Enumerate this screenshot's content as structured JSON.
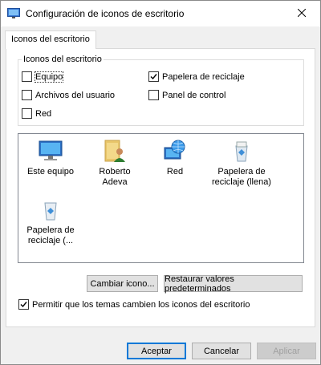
{
  "window": {
    "title": "Configuración de iconos de escritorio",
    "icon": "display-settings-icon",
    "close_icon": "close-icon"
  },
  "tabs": [
    {
      "label": "Iconos del escritorio",
      "selected": true
    }
  ],
  "desktop_icons_group": {
    "legend": "Iconos del escritorio",
    "checkboxes": [
      {
        "label": "Equipo",
        "checked": false
      },
      {
        "label": "Papelera de reciclaje",
        "checked": true
      },
      {
        "label": "Archivos del usuario",
        "checked": false
      },
      {
        "label": "Panel de control",
        "checked": false
      },
      {
        "label": "Red",
        "checked": false
      }
    ]
  },
  "icon_list": {
    "items": [
      {
        "label": "Este equipo",
        "icon": "computer-icon"
      },
      {
        "label": "Roberto Adeva",
        "icon": "user-folder-icon"
      },
      {
        "label": "Red",
        "icon": "network-globe-icon"
      },
      {
        "label": "Papelera de reciclaje (llena)",
        "icon": "recycle-bin-full-icon"
      },
      {
        "label": "Papelera de reciclaje (...",
        "icon": "recycle-bin-empty-icon"
      }
    ]
  },
  "buttons": {
    "change_icon": "Cambiar icono...",
    "restore_defaults": "Restaurar valores predeterminados",
    "accept": "Aceptar",
    "cancel": "Cancelar",
    "apply": "Aplicar"
  },
  "allow_themes": {
    "label": "Permitir que los temas cambien los iconos del escritorio",
    "checked": true
  },
  "colors": {
    "accent": "#0078d7",
    "panel_bg": "#f0f0f0",
    "button_bg": "#e1e1e1"
  }
}
